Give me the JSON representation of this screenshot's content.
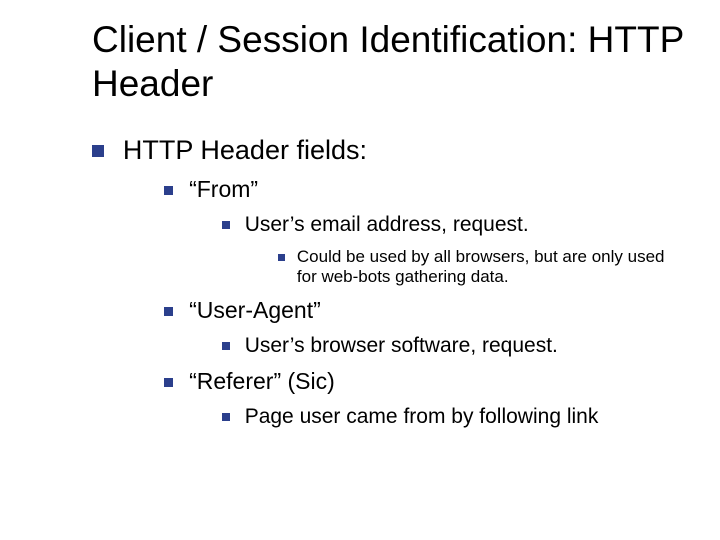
{
  "title": "Client / Session Identification: HTTP Header",
  "l1": {
    "text": "HTTP Header fields:"
  },
  "from": {
    "label": "“From”",
    "sub1": "User’s email address, request.",
    "sub1a": "Could be used by all browsers, but are only used for web-bots gathering data."
  },
  "useragent": {
    "label": "“User-Agent”",
    "sub1": "User’s browser software, request."
  },
  "referer": {
    "label": "“Referer” (Sic)",
    "sub1": "Page user came from by following link"
  }
}
